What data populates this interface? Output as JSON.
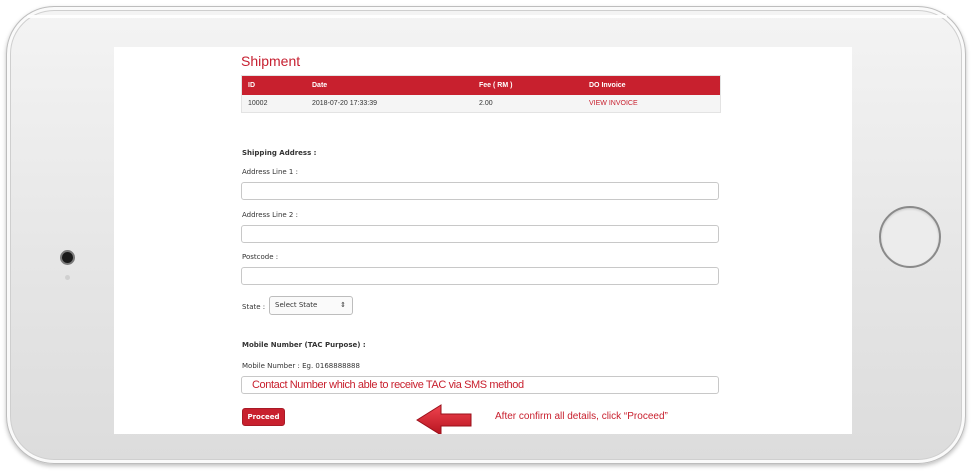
{
  "shipment": {
    "title": "Shipment",
    "columns": [
      "ID",
      "Date",
      "Fee ( RM )",
      "DO Invoice"
    ],
    "rows": [
      {
        "id": "10002",
        "date": "2018-07-20 17:33:39",
        "fee": "2.00",
        "invoice": "VIEW INVOICE"
      }
    ]
  },
  "form": {
    "shipping_heading": "Shipping Address :",
    "address1_label": "Address Line 1 :",
    "address2_label": "Address Line 2 :",
    "postcode_label": "Postcode :",
    "state_label": "State :",
    "state_value": "Select State",
    "mobile_heading": "Mobile Number (TAC Purpose) :",
    "mobile_label": "Mobile Number : Eg. 0168888888",
    "mobile_annotation": "Contact Number which able to receive TAC via SMS method",
    "proceed_label": "Proceed"
  },
  "annotation": {
    "callout": "After confirm all details, click “Proceed”"
  },
  "colors": {
    "accent": "#c8202e",
    "frame": "#e6e6e6"
  },
  "icons": {
    "caret": "updown-caret-icon",
    "arrow": "left-arrow-icon"
  }
}
